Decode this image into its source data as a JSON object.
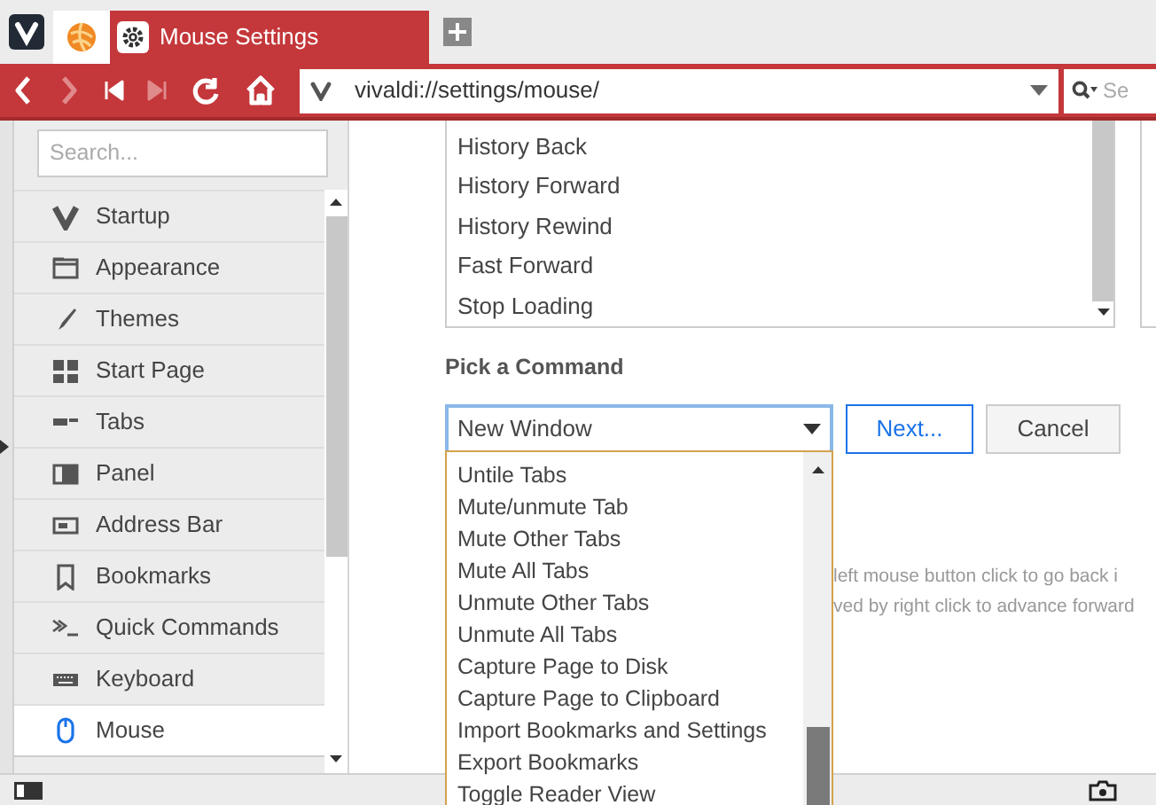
{
  "tabs": [
    {
      "kind": "favicon",
      "selected": false
    },
    {
      "kind": "page",
      "title": "Mouse Settings",
      "selected": true
    }
  ],
  "toolbar": {
    "nav_buttons": [
      {
        "disabled": false
      },
      {
        "disabled": true
      },
      {
        "disabled": false
      },
      {
        "disabled": true
      },
      {
        "disabled": false
      },
      {
        "disabled": false
      }
    ],
    "address": "vivaldi://settings/mouse/",
    "search_placeholder": "Se"
  },
  "sidebar": {
    "search_placeholder": "Search...",
    "items": [
      {
        "label": "Startup",
        "selected": false
      },
      {
        "label": "Appearance",
        "selected": false
      },
      {
        "label": "Themes",
        "selected": false
      },
      {
        "label": "Start Page",
        "selected": false
      },
      {
        "label": "Tabs",
        "selected": false
      },
      {
        "label": "Panel",
        "selected": false
      },
      {
        "label": "Address Bar",
        "selected": false
      },
      {
        "label": "Bookmarks",
        "selected": false
      },
      {
        "label": "Quick Commands",
        "selected": false
      },
      {
        "label": "Keyboard",
        "selected": false
      },
      {
        "label": "Mouse",
        "selected": true
      }
    ]
  },
  "gesture_commands": [
    "History Back",
    "History Forward",
    "History Rewind",
    "Fast Forward",
    "Stop Loading"
  ],
  "pick_command": {
    "label": "Pick a Command",
    "value": "New Window",
    "buttons": [
      {
        "label": "Next...",
        "kind": "primary"
      },
      {
        "label": "Cancel",
        "kind": "secondary"
      }
    ],
    "options": [
      "Untile Tabs",
      "Mute/unmute Tab",
      "Mute Other Tabs",
      "Mute All Tabs",
      "Unmute Other Tabs",
      "Unmute All Tabs",
      "Capture Page to Disk",
      "Capture Page to Clipboard",
      "Import Bookmarks and Settings",
      "Export Bookmarks",
      "Toggle Reader View"
    ]
  },
  "description": [
    "left mouse button click to go back i",
    "ved by right click to advance forward"
  ]
}
